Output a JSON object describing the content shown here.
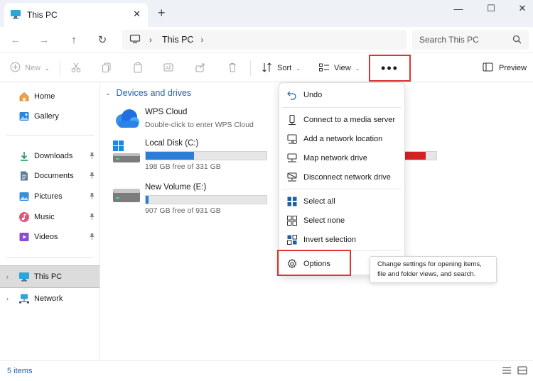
{
  "window": {
    "tab_title": "This PC",
    "close_glyph": "✕",
    "newtab_glyph": "+",
    "min_glyph": "—",
    "max_glyph": "☐",
    "winclose_glyph": "✕"
  },
  "address": {
    "back_glyph": "←",
    "forward_glyph": "→",
    "up_glyph": "↑",
    "refresh_glyph": "↻",
    "crumb": "This PC",
    "chevron": "›",
    "search_placeholder": "Search This PC"
  },
  "toolbar": {
    "new_label": "New",
    "sort_label": "Sort",
    "view_label": "View",
    "more_label": "•••",
    "preview_label": "Preview",
    "chev": "⌄"
  },
  "sidebar": {
    "items": [
      {
        "label": "Home",
        "icon": "home-icon"
      },
      {
        "label": "Gallery",
        "icon": "gallery-icon"
      },
      {
        "label": "Downloads",
        "icon": "download-icon"
      },
      {
        "label": "Documents",
        "icon": "documents-icon"
      },
      {
        "label": "Pictures",
        "icon": "pictures-icon"
      },
      {
        "label": "Music",
        "icon": "music-icon"
      },
      {
        "label": "Videos",
        "icon": "videos-icon"
      },
      {
        "label": "This PC",
        "icon": "pc-icon"
      },
      {
        "label": "Network",
        "icon": "network-icon"
      }
    ],
    "pin_glyph": "📌",
    "expand_glyph": "›"
  },
  "main": {
    "group_title": "Devices and drives",
    "group_chevron": "⌄",
    "drives": [
      {
        "name": "WPS Cloud",
        "subtitle": "Double-click to enter WPS Cloud"
      },
      {
        "name": "Local Disk (C:)",
        "subtitle": "198 GB free of 331 GB",
        "used_fraction": 0.4
      },
      {
        "name": "New Volume (E:)",
        "subtitle": "907 GB free of 931 GB",
        "used_fraction": 0.026
      }
    ],
    "hidden_drive_used_fraction": 0.67
  },
  "menu": {
    "items": [
      {
        "label": "Undo",
        "icon": "undo-icon"
      },
      {
        "label": "Connect to a media server",
        "icon": "media-server-icon"
      },
      {
        "label": "Add a network location",
        "icon": "network-location-icon"
      },
      {
        "label": "Map network drive",
        "icon": "map-drive-icon"
      },
      {
        "label": "Disconnect network drive",
        "icon": "disconnect-drive-icon"
      },
      {
        "label": "Select all",
        "icon": "select-all-icon"
      },
      {
        "label": "Select none",
        "icon": "select-none-icon"
      },
      {
        "label": "Invert selection",
        "icon": "invert-selection-icon"
      },
      {
        "label": "Options",
        "icon": "options-gear-icon"
      }
    ]
  },
  "tooltip": {
    "text": "Change settings for opening items, file and folder views, and search."
  },
  "status": {
    "item_count": "5 items"
  },
  "colors": {
    "accent": "#1b5fa8",
    "highlight_border": "#e03232",
    "drive_bar": "#2a7ed6",
    "drive_bar_full": "#d32222"
  }
}
